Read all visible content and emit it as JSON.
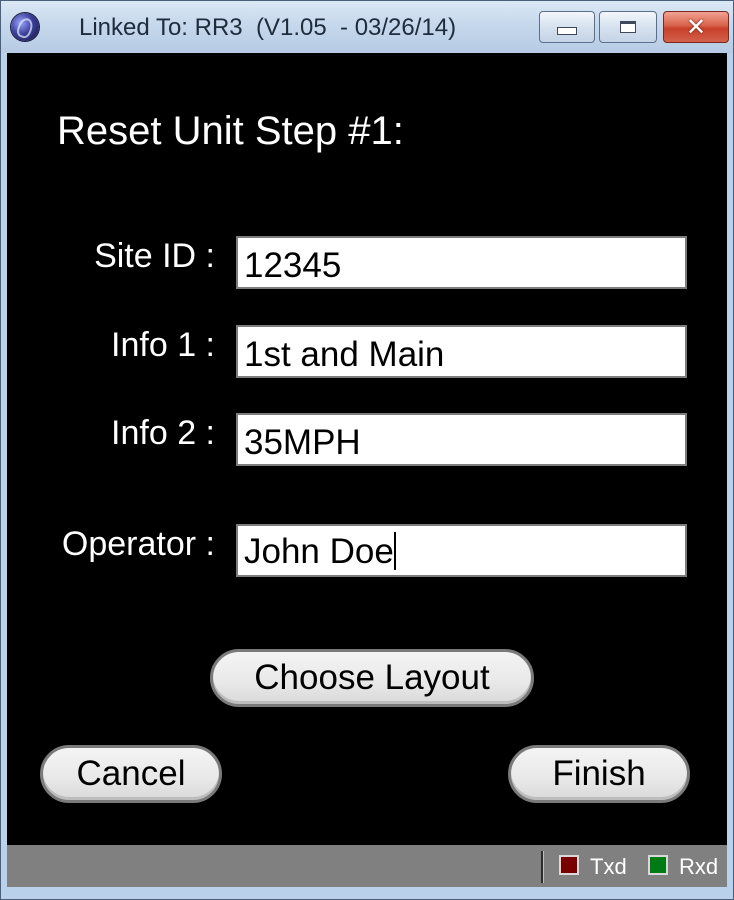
{
  "window": {
    "title": "Linked To: RR3  (V1.05  - 03/26/14)",
    "controls": {
      "minimize_icon": "minimize-icon",
      "maximize_icon": "maximize-icon",
      "close_icon": "close-icon",
      "close_glyph": "✕"
    }
  },
  "form": {
    "heading": "Reset Unit Step #1:",
    "fields": [
      {
        "label": "Site ID :",
        "value": "12345"
      },
      {
        "label": "Info 1 :",
        "value": "1st and Main"
      },
      {
        "label": "Info 2 :",
        "value": "35MPH"
      },
      {
        "label": "Operator :",
        "value": "John Doe"
      }
    ]
  },
  "buttons": {
    "choose_layout": "Choose Layout",
    "cancel": "Cancel",
    "finish": "Finish"
  },
  "status": {
    "txd_label": "Txd",
    "rxd_label": "Rxd",
    "txd_color": "#7a0000",
    "rxd_color": "#007a12"
  }
}
